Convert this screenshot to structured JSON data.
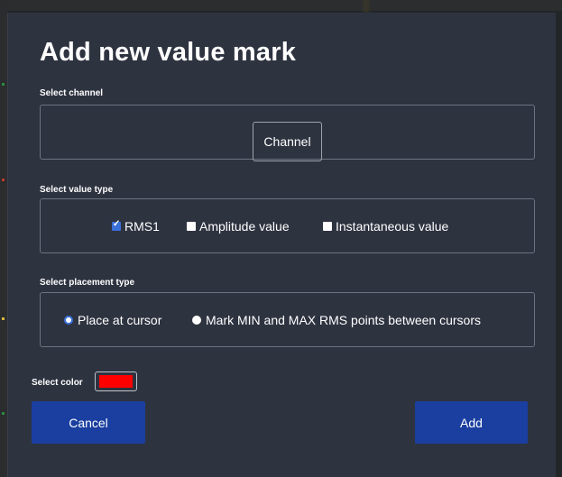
{
  "dialog": {
    "title": "Add new value mark",
    "channel_section": {
      "label": "Select channel",
      "button_label": "Channel"
    },
    "value_type_section": {
      "label": "Select value type",
      "options": [
        {
          "label": "RMS1",
          "checked": true
        },
        {
          "label": "Amplitude value",
          "checked": false
        },
        {
          "label": "Instantaneous value",
          "checked": false
        }
      ]
    },
    "placement_section": {
      "label": "Select placement type",
      "options": [
        {
          "label": "Place at cursor",
          "selected": true
        },
        {
          "label": "Mark MIN and MAX RMS points between cursors",
          "selected": false
        }
      ]
    },
    "color_section": {
      "label": "Select color",
      "value": "#ff0000"
    },
    "cancel_label": "Cancel",
    "add_label": "Add"
  },
  "colors": {
    "dialog_background": "#2e3340",
    "primary_button": "#1a3fa0",
    "accent": "#3a6fd8"
  }
}
